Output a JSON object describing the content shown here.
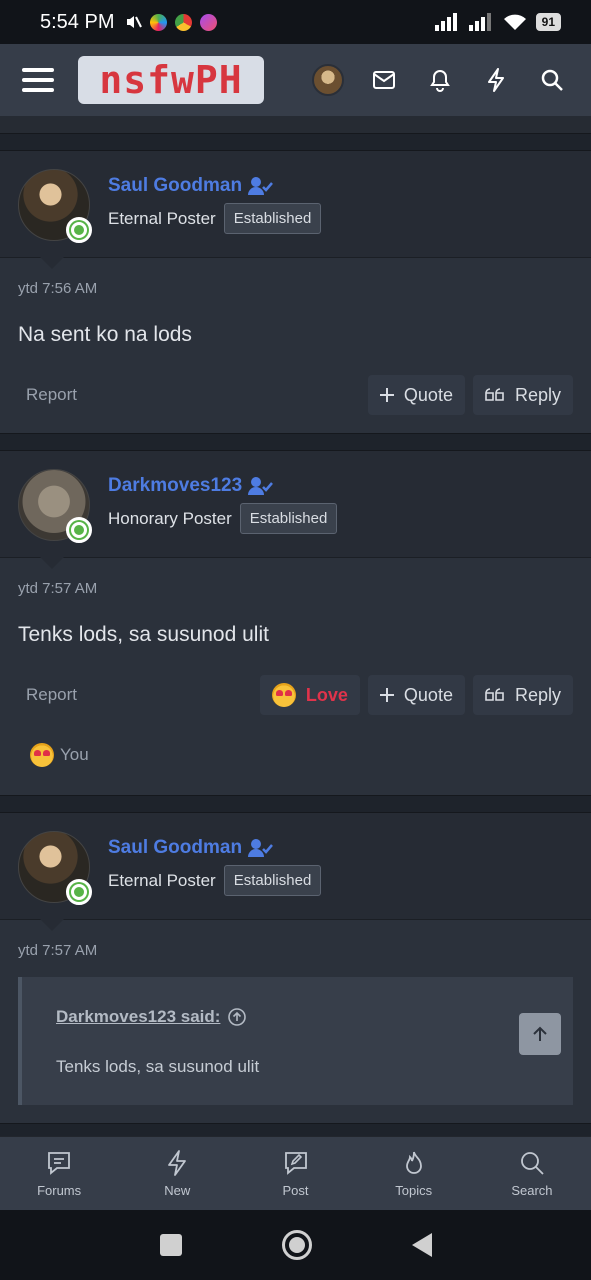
{
  "status": {
    "time": "5:54 PM",
    "battery": "91"
  },
  "header": {
    "logo": "nsfwPH"
  },
  "posts": [
    {
      "author": "Saul Goodman",
      "user_title": "Eternal Poster",
      "badge": "Established",
      "date": "ytd 7:56 AM",
      "message": "Na sent ko na lods",
      "report": "Report",
      "quote": "Quote",
      "reply": "Reply"
    },
    {
      "author": "Darkmoves123",
      "user_title": "Honorary Poster",
      "badge": "Established",
      "date": "ytd 7:57 AM",
      "message": "Tenks lods, sa susunod ulit",
      "report": "Report",
      "love": "Love",
      "quote": "Quote",
      "reply": "Reply",
      "reaction_by": "You"
    },
    {
      "author": "Saul Goodman",
      "user_title": "Eternal Poster",
      "badge": "Established",
      "date": "ytd 7:57 AM",
      "quote_author": "Darkmoves123 said:",
      "quote_text": "Tenks lods, sa susunod ulit"
    }
  ],
  "bottom_nav": [
    "Forums",
    "New",
    "Post",
    "Topics",
    "Search"
  ]
}
